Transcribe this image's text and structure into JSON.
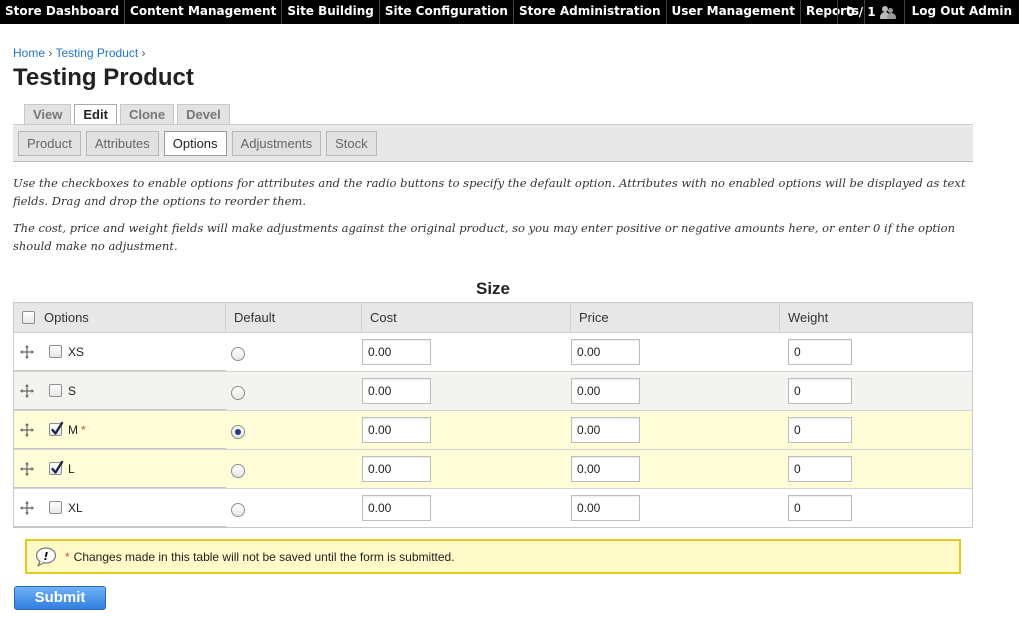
{
  "toolbar": {
    "menu": [
      "Store Dashboard",
      "Content Management",
      "Site Building",
      "Site Configuration",
      "Store Administration",
      "User Management",
      "Reports"
    ],
    "users_count": "0 / 1",
    "logout": "Log Out Admin"
  },
  "breadcrumb": {
    "items": [
      "Home",
      "Testing Product"
    ],
    "separator": "›"
  },
  "page_title": "Testing Product",
  "primary_tabs": [
    {
      "label": "View",
      "active": false
    },
    {
      "label": "Edit",
      "active": true
    },
    {
      "label": "Clone",
      "active": false
    },
    {
      "label": "Devel",
      "active": false
    }
  ],
  "secondary_tabs": [
    {
      "label": "Product",
      "active": false
    },
    {
      "label": "Attributes",
      "active": false
    },
    {
      "label": "Options",
      "active": true
    },
    {
      "label": "Adjustments",
      "active": false
    },
    {
      "label": "Stock",
      "active": false
    }
  ],
  "help": {
    "p1": "Use the checkboxes to enable options for attributes and the radio buttons to specify the default option. Attributes with no enabled options will be displayed as text fields. Drag and drop the options to reorder them.",
    "p2": "The cost, price and weight fields will make adjustments against the original product, so you may enter positive or negative amounts here, or enter 0 if the option should make no adjustment."
  },
  "table": {
    "caption": "Size",
    "headers": {
      "options": "Options",
      "default": "Default",
      "cost": "Cost",
      "price": "Price",
      "weight": "Weight"
    },
    "rows": [
      {
        "label": "XS",
        "enabled": false,
        "default": false,
        "required": "",
        "cost": "0.00",
        "price": "0.00",
        "weight": "0"
      },
      {
        "label": "S",
        "enabled": false,
        "default": false,
        "required": "",
        "cost": "0.00",
        "price": "0.00",
        "weight": "0"
      },
      {
        "label": "M",
        "enabled": true,
        "default": true,
        "required": "*",
        "cost": "0.00",
        "price": "0.00",
        "weight": "0"
      },
      {
        "label": "L",
        "enabled": true,
        "default": false,
        "required": "",
        "cost": "0.00",
        "price": "0.00",
        "weight": "0"
      },
      {
        "label": "XL",
        "enabled": false,
        "default": false,
        "required": "",
        "cost": "0.00",
        "price": "0.00",
        "weight": "0"
      }
    ]
  },
  "warning": {
    "star": "*",
    "text": "Changes made in this table will not be saved until the form is submitted."
  },
  "submit_label": "Submit",
  "colors": {
    "link": "#2175c8",
    "selected_row": "#fffcd8",
    "warning_border": "#e3c91e",
    "required_star": "#e04f1d"
  }
}
